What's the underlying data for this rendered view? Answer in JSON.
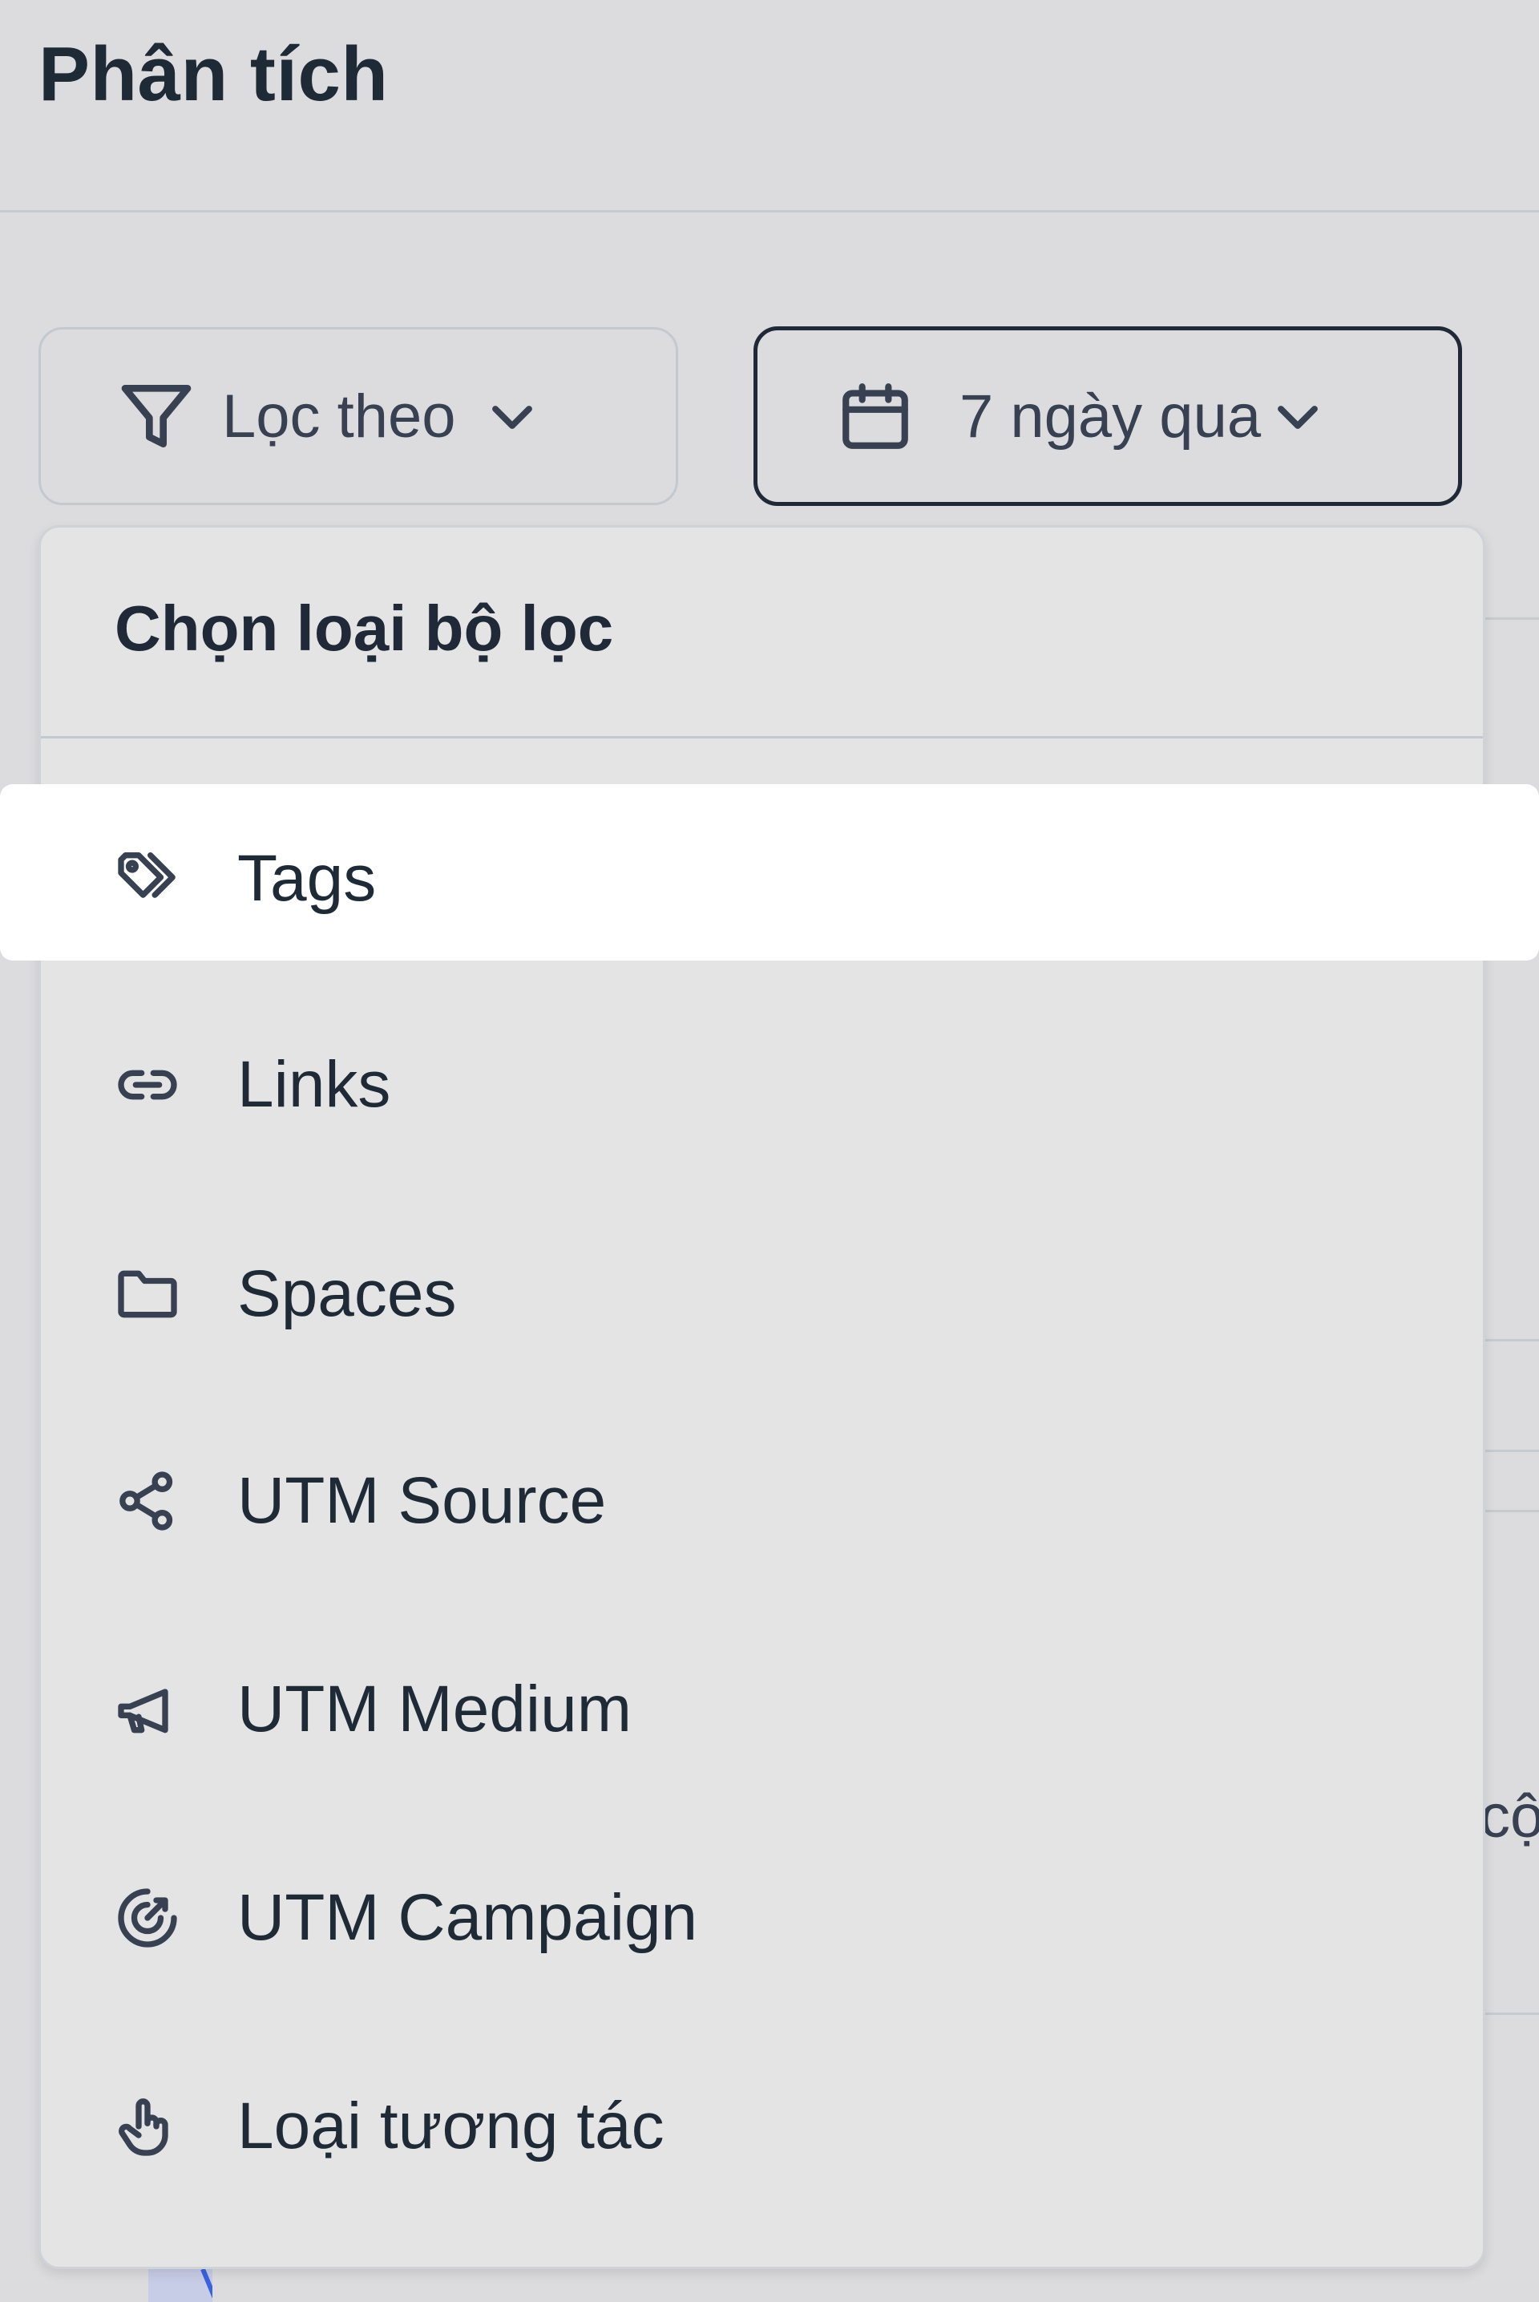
{
  "page": {
    "title": "Phân tích"
  },
  "toolbar": {
    "filter_button": {
      "label": "Lọc theo",
      "icon": "filter-icon"
    },
    "date_button": {
      "label": "7 ngày qua",
      "icon": "calendar-icon"
    }
  },
  "dropdown": {
    "title": "Chọn loại bộ lọc",
    "items": [
      {
        "label": "Tags",
        "icon": "tag-icon",
        "highlighted": true
      },
      {
        "label": "Links",
        "icon": "link-icon"
      },
      {
        "label": "Spaces",
        "icon": "folder-icon"
      },
      {
        "label": "UTM Source",
        "icon": "share-icon"
      },
      {
        "label": "UTM Medium",
        "icon": "megaphone-icon"
      },
      {
        "label": "UTM Campaign",
        "icon": "target-icon"
      },
      {
        "label": "Loại tương tác",
        "icon": "pointer-hand-icon"
      }
    ]
  },
  "background": {
    "partial_text": "cộ"
  }
}
